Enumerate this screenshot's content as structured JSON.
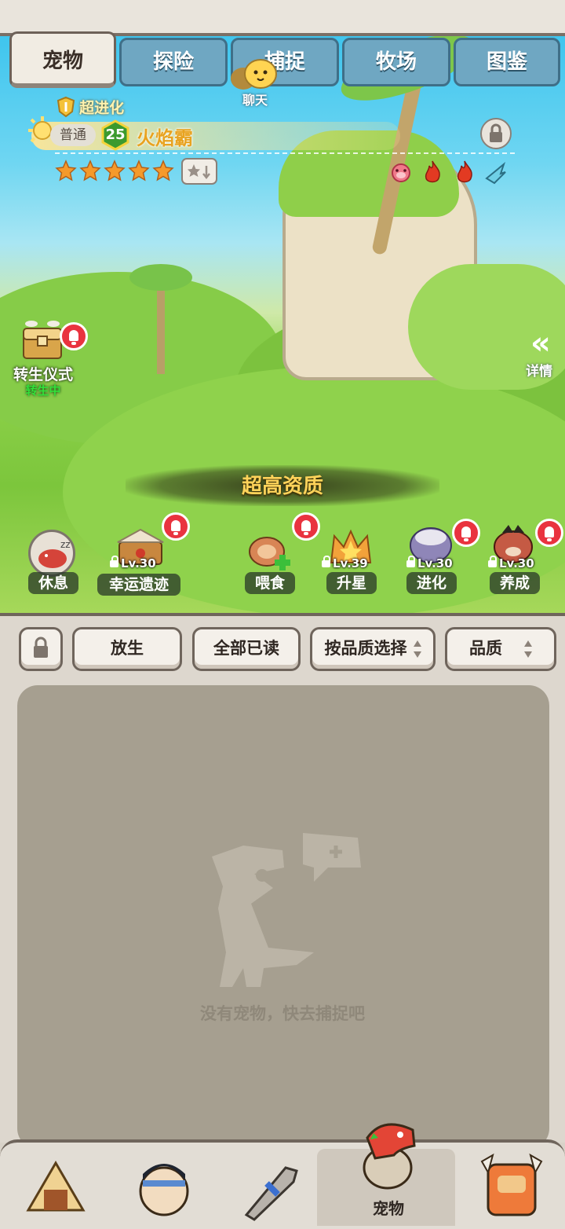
{
  "tabs": [
    {
      "label": "宠物"
    },
    {
      "label": "探险"
    },
    {
      "label": "捕捉"
    },
    {
      "label": "牧场"
    },
    {
      "label": "图鉴"
    }
  ],
  "chat": {
    "label": "聊天"
  },
  "pet": {
    "evolution_badge": "超进化",
    "rarity": "普通",
    "level": "25",
    "name": "火焰霸",
    "stars": 5,
    "element_icons": [
      "pig-face-icon",
      "fire-icon",
      "fire-icon",
      "wind-wing-icon"
    ]
  },
  "rebirth": {
    "label": "转生仪式",
    "status": "转生中"
  },
  "details": {
    "arrow": "«",
    "label": "详情"
  },
  "quality_banner": "超高资质",
  "actions": [
    {
      "label": "休息",
      "lock": ""
    },
    {
      "label": "幸运遗迹",
      "lock": "Lv.30"
    },
    {
      "label": "喂食",
      "lock": ""
    },
    {
      "label": "升星",
      "lock": "Lv.39"
    },
    {
      "label": "进化",
      "lock": "Lv.30"
    },
    {
      "label": "养成",
      "lock": "Lv.30"
    }
  ],
  "controls": {
    "release": "放生",
    "mark_all_read": "全部已读",
    "select_by_quality": "按品质选择",
    "quality_sort": "品质"
  },
  "empty_state": {
    "message": "没有宠物，快去捕捉吧"
  },
  "nav": [
    {
      "label": ""
    },
    {
      "label": ""
    },
    {
      "label": ""
    },
    {
      "label": "宠物"
    },
    {
      "label": ""
    }
  ],
  "colors": {
    "accent_gold": "#ffd35a",
    "alert_red": "#e9333f",
    "level_green": "#3c9a2e",
    "empty_bg": "#a69f90"
  }
}
